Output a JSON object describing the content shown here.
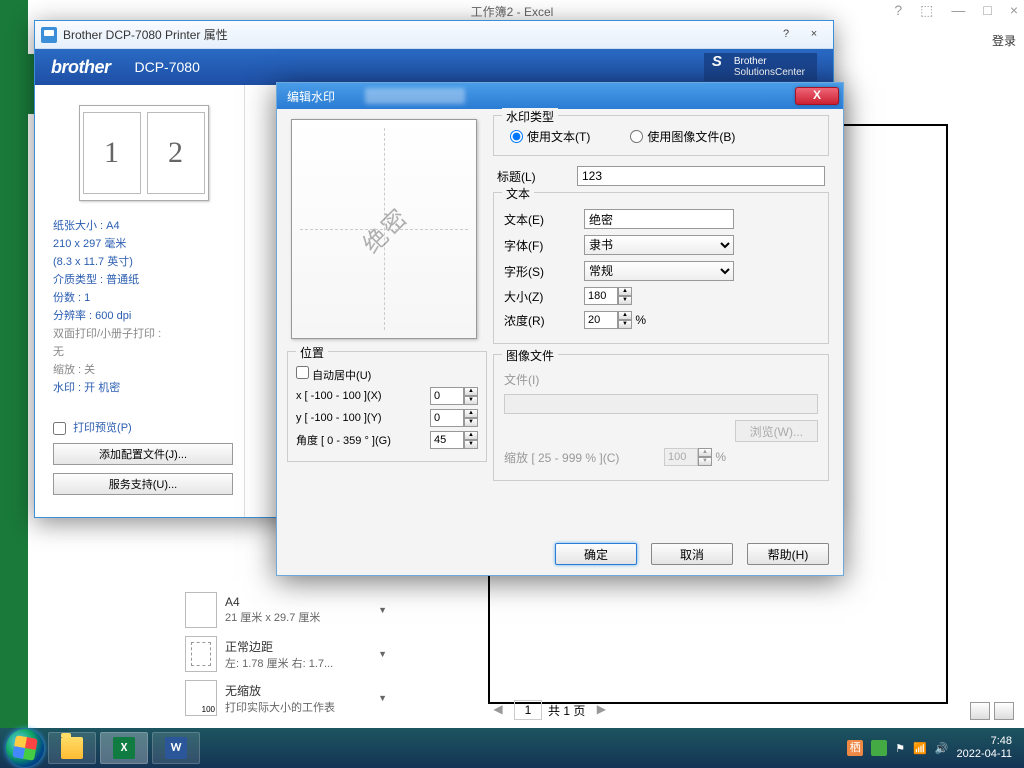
{
  "excel": {
    "title": "工作簿2 - Excel",
    "login": "登录",
    "settings": {
      "paper": {
        "title": "A4",
        "detail": "21 厘米 x 29.7 厘米"
      },
      "margins": {
        "title": "正常边距",
        "detail": "左: 1.78 厘米  右: 1.7..."
      },
      "scale": {
        "title": "无缩放",
        "detail": "打印实际大小的工作表",
        "badge": "100"
      }
    },
    "page_nav": {
      "current": "1",
      "total": "共 1 页"
    }
  },
  "props": {
    "window_title": "Brother DCP-7080 Printer 属性",
    "brand": "brother",
    "model": "DCP-7080",
    "solutions_l1": "Brother",
    "solutions_l2": "SolutionsCenter",
    "thumb": {
      "p1": "1",
      "p2": "2"
    },
    "info": {
      "paper_size": "纸张大小 : A4",
      "paper_mm": "210 x 297 毫米",
      "paper_in": "(8.3 x 11.7 英寸)",
      "media": "介质类型 : 普通纸",
      "copies": "份数 : 1",
      "dpi": "分辨率 : 600 dpi",
      "duplex": "双面打印/小册子打印 :",
      "duplex_val": "无",
      "zoom": "缩放 : 关",
      "watermark": "水印 : 开  机密"
    },
    "preview_chk": "打印预览(P)",
    "btn_profile": "添加配置文件(J)...",
    "btn_support": "服务支持(U)..."
  },
  "wm": {
    "title": "编辑水印",
    "preview_text": "绝密",
    "type": {
      "legend": "水印类型",
      "use_text": "使用文本(T)",
      "use_image": "使用图像文件(B)"
    },
    "title_row": {
      "label": "标题(L)",
      "value": "123"
    },
    "text_group": {
      "legend": "文本",
      "text_label": "文本(E)",
      "text_value": "绝密",
      "font_label": "字体(F)",
      "font_value": "隶书",
      "style_label": "字形(S)",
      "style_value": "常规",
      "size_label": "大小(Z)",
      "size_value": "180",
      "density_label": "浓度(R)",
      "density_value": "20",
      "density_suffix": "%"
    },
    "image_group": {
      "legend": "图像文件",
      "file_label": "文件(I)",
      "browse": "浏览(W)...",
      "zoom_label": "缩放 [ 25 - 999 % ](C)",
      "zoom_value": "100",
      "zoom_suffix": "%"
    },
    "pos": {
      "legend": "位置",
      "auto_center": "自动居中(U)",
      "x_label": "x [ -100  -  100 ](X)",
      "x_value": "0",
      "y_label": "y [ -100  -  100 ](Y)",
      "y_value": "0",
      "angle_label": "角度 [ 0 - 359 ° ](G)",
      "angle_value": "45"
    },
    "buttons": {
      "ok": "确定",
      "cancel": "取消",
      "help": "帮助(H)"
    }
  },
  "taskbar": {
    "ime": "栖",
    "time": "7:48",
    "date": "2022-04-11"
  }
}
